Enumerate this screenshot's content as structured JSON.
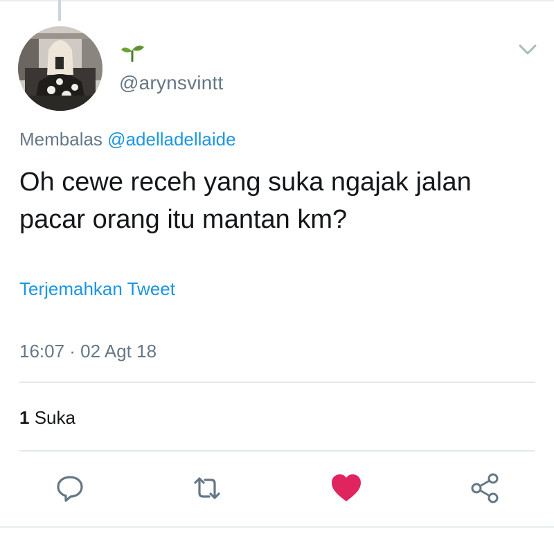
{
  "author": {
    "display_name_icon": "sprout-icon",
    "handle": "@arynsvintt"
  },
  "reply_context": {
    "prefix": "Membalas",
    "mention": "@adelladellaide"
  },
  "tweet": {
    "text": "Oh cewe receh yang suka ngajak jalan pacar orang itu mantan km?",
    "translate_label": "Terjemahkan Tweet",
    "timestamp": "16:07 · 02 Agt 18"
  },
  "stats": {
    "like_count": "1",
    "like_label": "Suka"
  },
  "actions": [
    {
      "name": "reply",
      "icon": "speech-bubble-icon"
    },
    {
      "name": "retweet",
      "icon": "retweet-icon"
    },
    {
      "name": "like",
      "icon": "heart-icon",
      "active": true
    },
    {
      "name": "share",
      "icon": "share-icon"
    }
  ],
  "colors": {
    "link": "#1b95e0",
    "secondary_text": "#657786",
    "primary_text": "#14171a",
    "like_active": "#e0245e",
    "icon_gray": "#657786",
    "sprout_green": "#4a7a2a"
  }
}
